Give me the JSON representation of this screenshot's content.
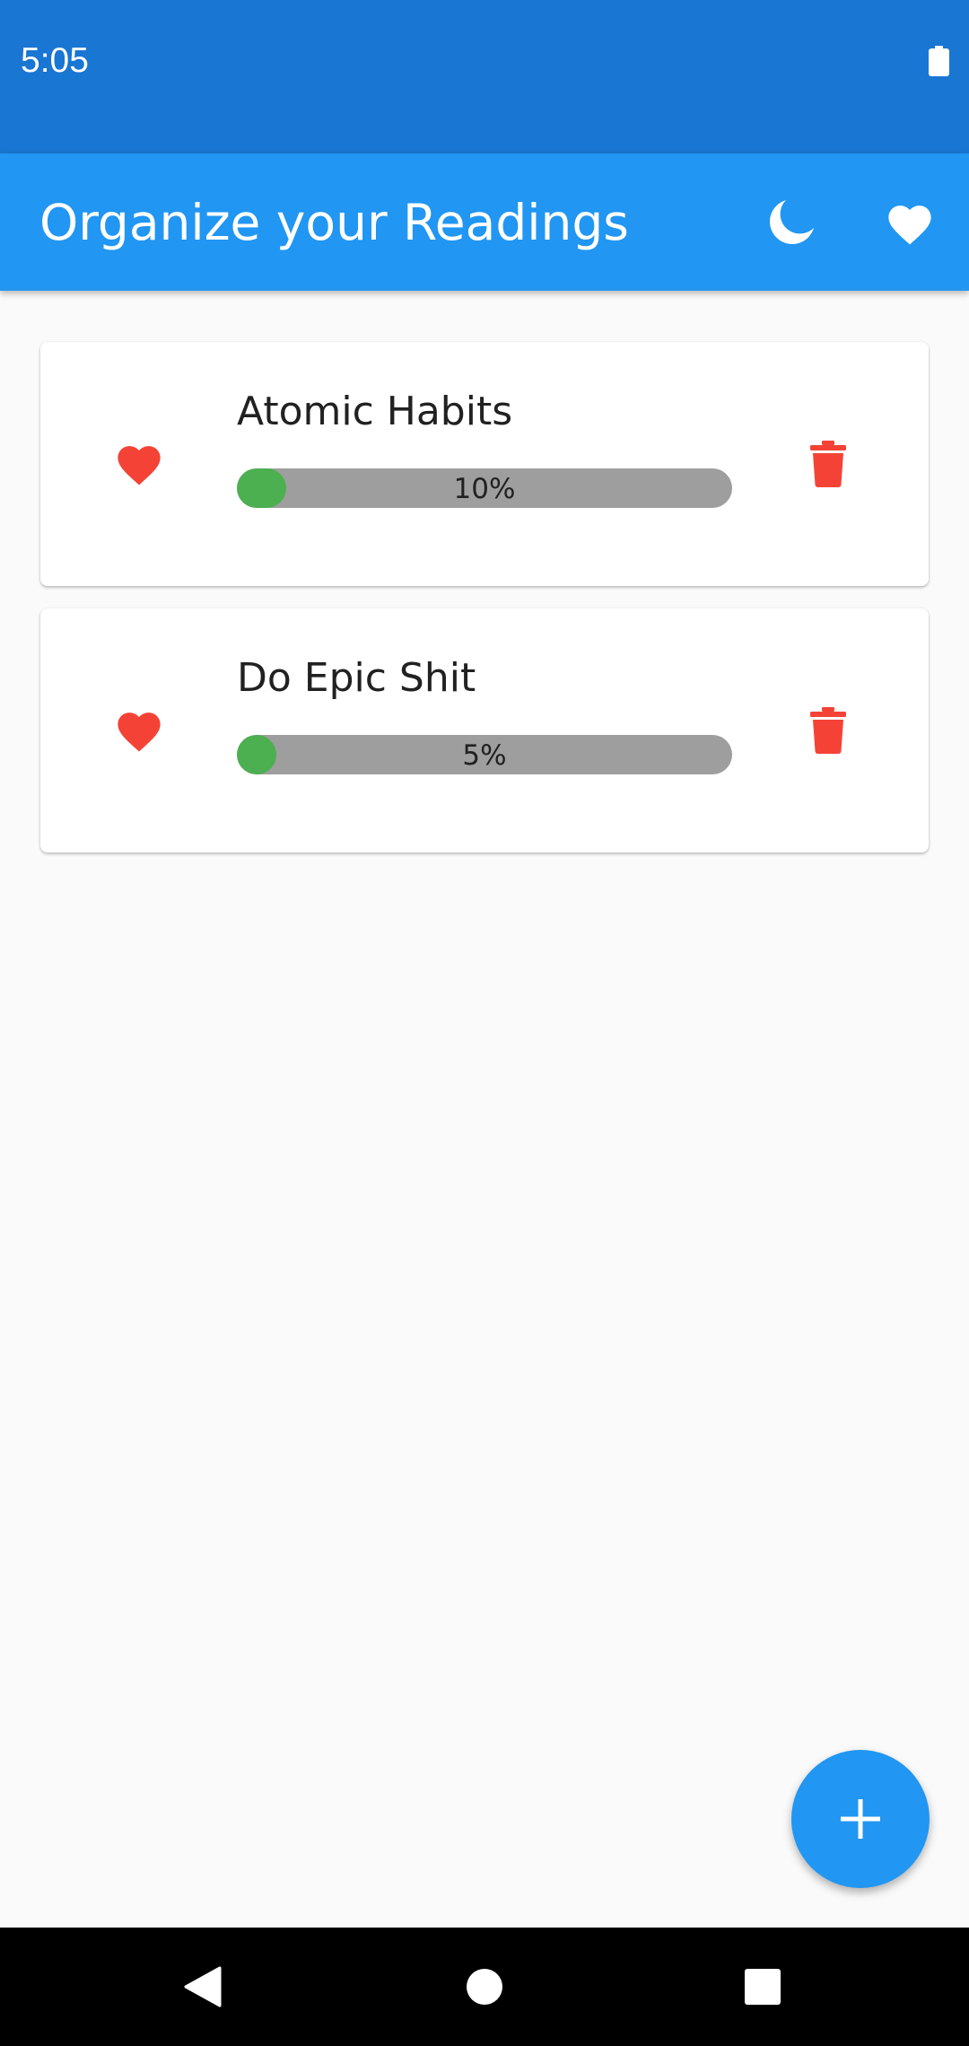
{
  "status_bar": {
    "time": "5:05",
    "battery_icon": "battery-full-icon"
  },
  "app_bar": {
    "title": "Organize your Readings",
    "actions": [
      {
        "icon": "moon-icon"
      },
      {
        "icon": "heart-icon"
      }
    ]
  },
  "books": [
    {
      "title": "Atomic Habits",
      "progress_label": "10%",
      "progress": 0.1,
      "favorite_icon": "heart-icon",
      "delete_icon": "trash-icon"
    },
    {
      "title": "Do Epic Shit",
      "progress_label": "5%",
      "progress": 0.05,
      "favorite_icon": "heart-icon",
      "delete_icon": "trash-icon"
    }
  ],
  "fab": {
    "icon": "plus-icon"
  },
  "nav_bar": {
    "buttons": [
      {
        "icon": "back-triangle-icon"
      },
      {
        "icon": "home-circle-icon"
      },
      {
        "icon": "recents-square-icon"
      }
    ]
  },
  "colors": {
    "status_bar": "#1976D2",
    "primary": "#2196F3",
    "background": "#FAFAFA",
    "card": "#FFFFFF",
    "favorite": "#F44336",
    "delete": "#F44336",
    "progress_fill": "#4CAF50",
    "progress_track": "#9E9E9E",
    "on_primary": "#FFFFFF",
    "nav_bar": "#000000"
  }
}
